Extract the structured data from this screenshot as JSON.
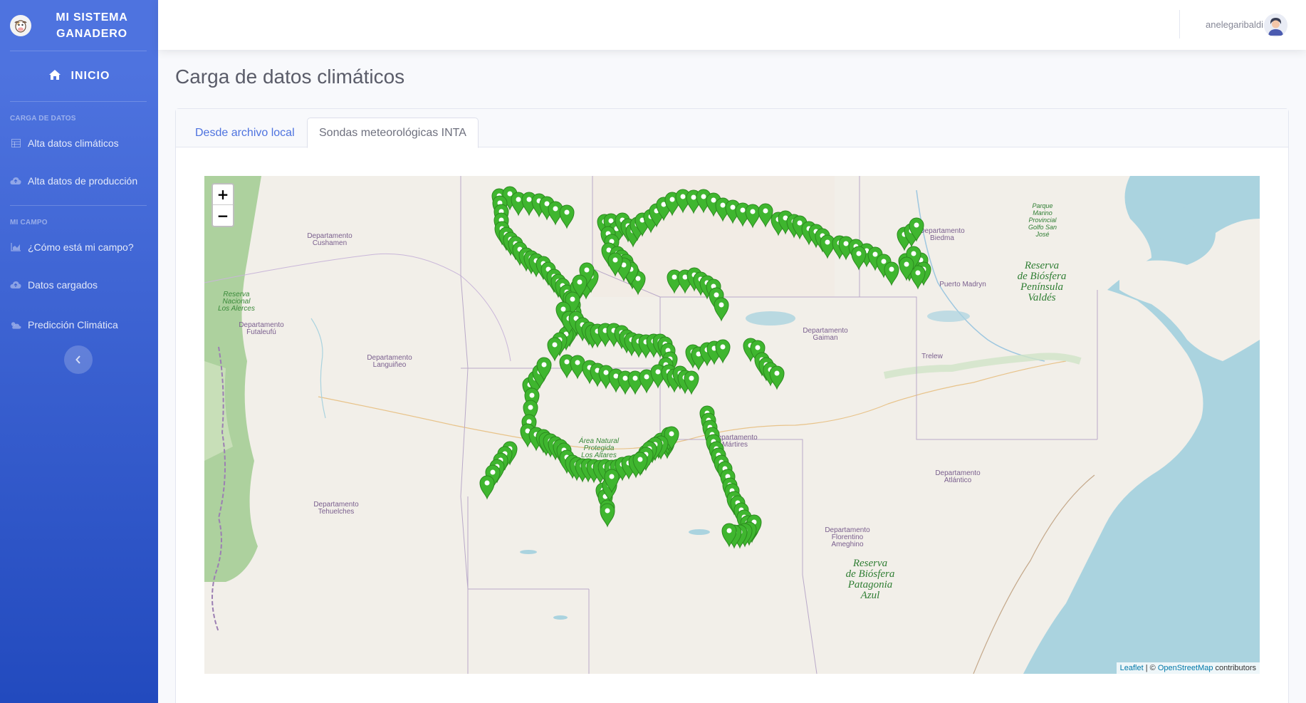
{
  "sidebar": {
    "brand": "MI SISTEMA GANADERO",
    "home_label": "INICIO",
    "section_1": "CARGA DE DATOS",
    "section_2": "MI CAMPO",
    "items": [
      {
        "label": "Alta datos climáticos",
        "icon": "table-icon"
      },
      {
        "label": "Alta datos de producción",
        "icon": "cloud-upload-icon"
      },
      {
        "label": "¿Cómo está mi campo?",
        "icon": "chart-area-icon"
      },
      {
        "label": "Datos cargados",
        "icon": "cloud-upload-icon"
      },
      {
        "label": "Predicción Climática",
        "icon": "cloud-sun-icon"
      }
    ]
  },
  "topbar": {
    "username": "anelegaribaldi"
  },
  "page": {
    "title": "Carga de datos climáticos",
    "tabs": [
      {
        "label": "Desde archivo local",
        "active": false
      },
      {
        "label": "Sondas meteorológicas INTA",
        "active": true
      }
    ]
  },
  "map": {
    "zoom_in": "+",
    "zoom_out": "−",
    "attribution_leaflet": "Leaflet",
    "attribution_sep": " | © ",
    "attribution_osm": "OpenStreetMap",
    "attribution_tail": " contributors",
    "marker_color": "#3fb62f",
    "labels": [
      {
        "text": "Departamento",
        "text2": "Cushamen"
      },
      {
        "text": "Departamento",
        "text2": "Futaleufú"
      },
      {
        "text": "Departamento",
        "text2": "Languiñeo"
      },
      {
        "text": "Departamento",
        "text2": "Tehuelches"
      },
      {
        "text": "Departamento",
        "text2": "Gaiman"
      },
      {
        "text": "Departamento",
        "text2": "Biedma"
      },
      {
        "text": "Departamento",
        "text2": "Mártires"
      },
      {
        "text": "Departamento",
        "text2": "Atlántico"
      },
      {
        "text": "Departamento",
        "text2": "Florentino",
        "text3": "Ameghino"
      },
      {
        "text": "Puerto Madryn"
      },
      {
        "text": "Trelew"
      }
    ],
    "green_labels": [
      {
        "lines": [
          "Reserva",
          "Nacional",
          "Los Alerces"
        ]
      },
      {
        "lines": [
          "Área Natural",
          "Protegida",
          "Los Altares"
        ]
      }
    ],
    "reserves": [
      {
        "lines": [
          "Reserva",
          "de Biósfera",
          "Península",
          "Valdés"
        ]
      },
      {
        "lines": [
          "Reserva",
          "de Biósfera",
          "Patagonia",
          "Azul"
        ]
      }
    ],
    "marine_park": {
      "lines": [
        "Parque",
        "Marino",
        "Provincial",
        "Golfo San",
        "José"
      ]
    }
  }
}
